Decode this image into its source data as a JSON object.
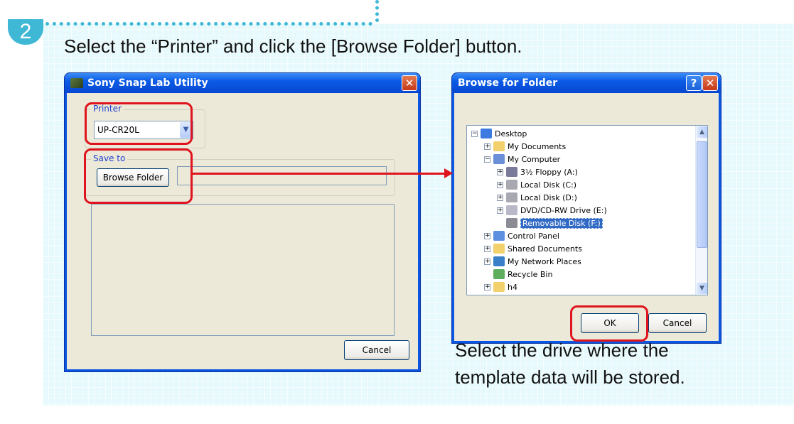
{
  "step": {
    "number": "2"
  },
  "instruction": "Select the “Printer” and click the [Browse Folder] button.",
  "note_lines": [
    "Select the drive where the",
    "template data will be stored."
  ],
  "utility_window": {
    "title": "Sony Snap Lab Utility",
    "close_glyph": "✕",
    "printer_group_label": "Printer",
    "printer_value": "UP-CR20L",
    "save_group_label": "Save to",
    "browse_button": "Browse Folder",
    "cancel_button": "Cancel"
  },
  "browse_dialog": {
    "title": "Browse for Folder",
    "help_glyph": "?",
    "close_glyph": "✕",
    "tree": [
      {
        "label": "Desktop",
        "expander": "−",
        "icon": "desktop-icon"
      },
      {
        "label": "My Documents",
        "expander": "+",
        "icon": "folder-icon"
      },
      {
        "label": "My Computer",
        "expander": "−",
        "icon": "computer-icon"
      },
      {
        "label": "3½ Floppy (A:)",
        "expander": "+",
        "icon": "floppy-icon"
      },
      {
        "label": "Local Disk (C:)",
        "expander": "+",
        "icon": "disk-icon"
      },
      {
        "label": "Local Disk (D:)",
        "expander": "+",
        "icon": "disk-icon"
      },
      {
        "label": "DVD/CD-RW Drive (E:)",
        "expander": "+",
        "icon": "cd-drive-icon"
      },
      {
        "label": "Removable Disk (F:)",
        "expander": "",
        "icon": "removable-disk-icon",
        "selected": true
      },
      {
        "label": "Control Panel",
        "expander": "+",
        "icon": "control-panel-icon"
      },
      {
        "label": "Shared Documents",
        "expander": "+",
        "icon": "folder-icon"
      },
      {
        "label": "My Network Places",
        "expander": "+",
        "icon": "network-icon"
      },
      {
        "label": "Recycle Bin",
        "expander": "",
        "icon": "recycle-bin-icon"
      },
      {
        "label": "h4",
        "expander": "+",
        "icon": "folder-icon"
      }
    ],
    "ok_button": "OK",
    "cancel_button": "Cancel"
  },
  "colors": {
    "highlight": "#e0141e",
    "accent": "#3fb8d6",
    "panel": "#e6f9fc"
  }
}
